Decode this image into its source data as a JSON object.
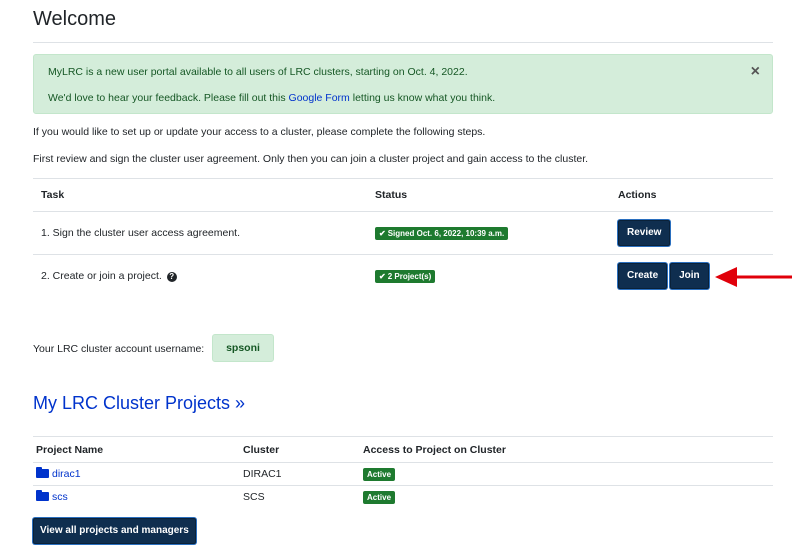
{
  "page": {
    "title": "Welcome"
  },
  "alert": {
    "line1": "MyLRC is a new user portal available to all users of LRC clusters, starting on Oct. 4, 2022.",
    "line2_before": "We'd love to hear your feedback. Please fill out this ",
    "line2_link": "Google Form",
    "line2_after": " letting us know what you think.",
    "close_glyph": "×"
  },
  "intro": {
    "line1": "If you would like to set up or update your access to a cluster, please complete the following steps.",
    "line2": "First review and sign the cluster user agreement. Only then you can join a cluster project and gain access to the cluster."
  },
  "tasks": {
    "headers": {
      "task": "Task",
      "status": "Status",
      "actions": "Actions"
    },
    "rows": [
      {
        "task": "1. Sign the cluster user access agreement.",
        "status": "Signed Oct. 6, 2022, 10:39 a.m.",
        "review_label": "Review"
      },
      {
        "task": "2. Create or join a project.",
        "status": "2 Project(s)",
        "create_label": "Create",
        "join_label": "Join"
      }
    ]
  },
  "username": {
    "label": "Your LRC cluster account username:",
    "value": "spsoni"
  },
  "projects_section": {
    "title": "My LRC Cluster Projects »",
    "headers": {
      "name": "Project Name",
      "cluster": "Cluster",
      "access": "Access to Project on Cluster"
    },
    "rows": [
      {
        "name": "dirac1",
        "cluster": "DIRAC1",
        "access": "Active"
      },
      {
        "name": "scs",
        "cluster": "SCS",
        "access": "Active"
      }
    ],
    "view_all_label": "View all projects and managers"
  },
  "colors": {
    "accent_link": "#0033cc",
    "button": "#0f2e4f",
    "success": "#1e7a2f",
    "alert_bg": "#d4edda",
    "arrow": "#e0000a"
  },
  "icons": {
    "check": "✔",
    "help": "?",
    "folder": "folder-icon",
    "arrow": "arrow-left-icon"
  }
}
